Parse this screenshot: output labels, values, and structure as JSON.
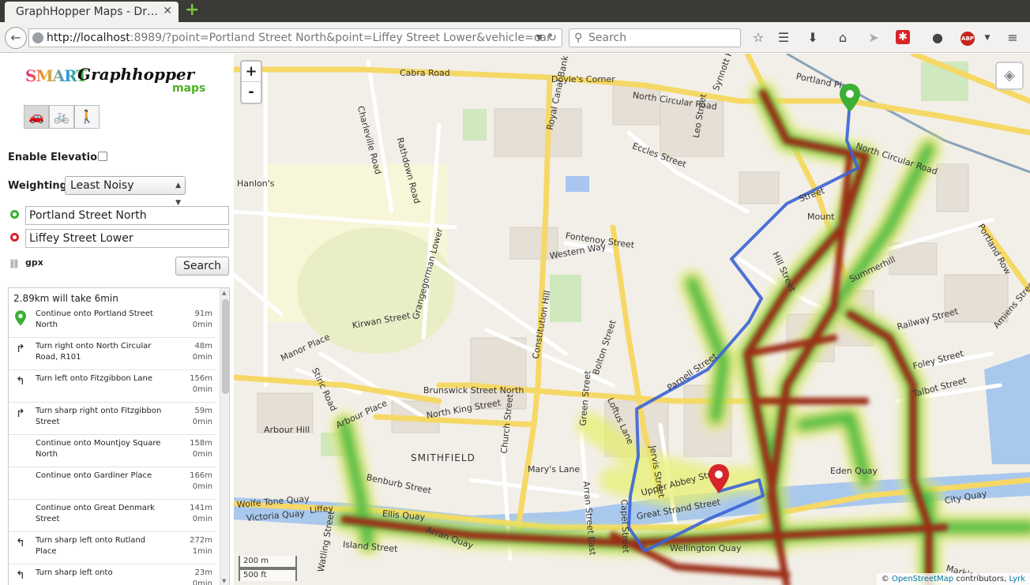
{
  "browser": {
    "tab_title": "GraphHopper Maps - Dr…",
    "tab_close": "✕",
    "new_tab": "+",
    "url_host": "http://localhost",
    "url_rest": ":8989/?point=Portland Street North&point=Liffey Street Lower&vehicle=car",
    "search_placeholder": "Search"
  },
  "sidebar": {
    "logo_smart": "SMART",
    "logo_graphhopper": "Graphhopper",
    "logo_maps": "maps",
    "vehicles": [
      {
        "icon": "car-icon",
        "glyph": "🚗"
      },
      {
        "icon": "bike-icon",
        "glyph": "🚲"
      },
      {
        "icon": "walk-icon",
        "glyph": "🚶"
      }
    ],
    "elevation_label": "Enable Elevation",
    "weighting_label": "Weighting:",
    "weighting_value": "Least Noisy",
    "from": "Portland Street North",
    "to": "Liffey Street Lower",
    "gpx_label": "gpx",
    "search_button": "Search",
    "summary": "2.89km will take 6min",
    "instructions": [
      {
        "icon": "start-pin-icon",
        "glyph": "",
        "text": "Continue onto Portland Street North",
        "dist": "91m",
        "time": "0min"
      },
      {
        "icon": "turn-right-icon",
        "glyph": "↱",
        "text": "Turn right onto North Circular Road, R101",
        "dist": "48m",
        "time": "0min"
      },
      {
        "icon": "turn-left-icon",
        "glyph": "↰",
        "text": "Turn left onto Fitzgibbon Lane",
        "dist": "156m",
        "time": "0min"
      },
      {
        "icon": "turn-sharp-right-icon",
        "glyph": "↱",
        "text": "Turn sharp right onto Fitzgibbon Street",
        "dist": "59m",
        "time": "0min"
      },
      {
        "icon": "",
        "glyph": "",
        "text": "Continue onto Mountjoy Square North",
        "dist": "158m",
        "time": "0min"
      },
      {
        "icon": "",
        "glyph": "",
        "text": "Continue onto Gardiner Place",
        "dist": "166m",
        "time": "0min"
      },
      {
        "icon": "",
        "glyph": "",
        "text": "Continue onto Great Denmark Street",
        "dist": "141m",
        "time": "0min"
      },
      {
        "icon": "turn-sharp-left-icon",
        "glyph": "↰",
        "text": "Turn sharp left onto Rutland Place",
        "dist": "272m",
        "time": "1min"
      },
      {
        "icon": "turn-sharp-left-icon",
        "glyph": "↰",
        "text": "Turn sharp left onto",
        "dist": "23m",
        "time": "0min"
      }
    ]
  },
  "map": {
    "zoom_in": "+",
    "zoom_out": "-",
    "scale_metric": "200 m",
    "scale_imperial": "500 ft",
    "attribution_prefix": "© ",
    "attribution_osm": "OpenStreetMap",
    "attribution_mid": " contributors, ",
    "attribution_lyrk": "Lyrk",
    "colors": {
      "route": "#3a63d6",
      "heat_core": "#9b2d12",
      "heat_mid": "#3cb83c",
      "heat_glow": "#e7f06a",
      "start": "#3cb035",
      "end": "#d6252b"
    },
    "labels": [
      {
        "text": "Cabra Road"
      },
      {
        "text": "Doyle's Corner"
      },
      {
        "text": "North Circular Road"
      },
      {
        "text": "Portland Place"
      },
      {
        "text": "Charleville Road"
      },
      {
        "text": "Rathdown Road"
      },
      {
        "text": "Royal Canal Bank"
      },
      {
        "text": "Eccles Street"
      },
      {
        "text": "Leo Street"
      },
      {
        "text": "Synnott Row"
      },
      {
        "text": "North Circular Road"
      },
      {
        "text": "Fontenoy Street"
      },
      {
        "text": "Western Way"
      },
      {
        "text": "Hill Street"
      },
      {
        "text": "Summerhill"
      },
      {
        "text": "Portland Row"
      },
      {
        "text": "Grangegorman Lower"
      },
      {
        "text": "Constitution Hill"
      },
      {
        "text": "Kirwan Street"
      },
      {
        "text": "Manor Place"
      },
      {
        "text": "Stiric Road"
      },
      {
        "text": "Bolton Street"
      },
      {
        "text": "Brunswick Street North"
      },
      {
        "text": "North King Street"
      },
      {
        "text": "Arbour Place"
      },
      {
        "text": "Arbour Hill"
      },
      {
        "text": "Loftus Lane"
      },
      {
        "text": "Parnell Street"
      },
      {
        "text": "Railway Street"
      },
      {
        "text": "Foley Street"
      },
      {
        "text": "Talbot Street"
      },
      {
        "text": "Amiens Street"
      },
      {
        "text": "Green Street"
      },
      {
        "text": "Jervis Street"
      },
      {
        "text": "Church Street"
      },
      {
        "text": "Mary's Lane"
      },
      {
        "text": "Arran Street East"
      },
      {
        "text": "Upper Abbey Street"
      },
      {
        "text": "Great Strand Street"
      },
      {
        "text": "Eden Quay"
      },
      {
        "text": "City Quay"
      },
      {
        "text": "Benburb Street"
      },
      {
        "text": "Wolfe Tone Quay"
      },
      {
        "text": "Liffey"
      },
      {
        "text": "Ellis Quay"
      },
      {
        "text": "Arran Quay"
      },
      {
        "text": "Victoria Quay"
      },
      {
        "text": "Island Street"
      },
      {
        "text": "Watling Street"
      },
      {
        "text": "Wellington Quay"
      },
      {
        "text": "Mark's Lane"
      },
      {
        "text": "Capel Street"
      },
      {
        "text": "Hanlon's"
      },
      {
        "text": "Mount"
      },
      {
        "text": "Street"
      }
    ],
    "district": "SMITHFIELD"
  }
}
